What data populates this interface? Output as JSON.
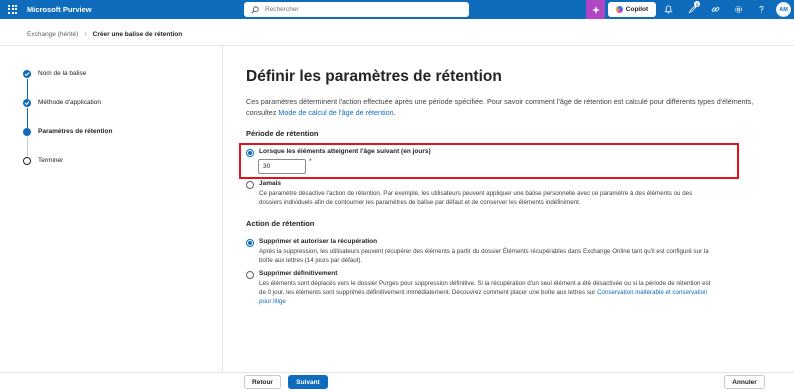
{
  "header": {
    "app_name": "Microsoft Purview",
    "search_placeholder": "Rechercher",
    "copilot_label": "Copilot",
    "notification_count": "1",
    "avatar_initials": "AM",
    "accent": "#0f6cbd",
    "copilot_accent": "#b146c2"
  },
  "breadcrumb": {
    "parent": "Exchange (hérité)",
    "separator": "›",
    "current": "Créer une balise de rétention"
  },
  "steps": [
    {
      "label": "Nom de la balise",
      "state": "done"
    },
    {
      "label": "Méthode d'application",
      "state": "done"
    },
    {
      "label": "Paramètres de rétention",
      "state": "current"
    },
    {
      "label": "Terminer",
      "state": "todo"
    }
  ],
  "main": {
    "title": "Définir les paramètres de rétention",
    "intro_text": "Ces paramètres déterminent l'action effectuée après une période spécifiée. Pour savoir comment l'âge de rétention est calculé pour différents types d'éléments, consultez ",
    "intro_link": "Mode de calcul de l'âge de rétention",
    "intro_end": ".",
    "retention_period_heading": "Période de rétention",
    "period_options": [
      {
        "label": "Lorsque les éléments atteignent l'âge suivant (en jours)",
        "checked": true
      },
      {
        "label": "Jamais",
        "checked": false,
        "desc": "Ce paramètre désactive l'action de rétention. Par exemple, les utilisateurs peuvent appliquer une balise personnelle avec ce paramètre à des éléments ou des dossiers individuels afin de contourner les paramètres de balise par défaut et de conserver les éléments indéfiniment."
      }
    ],
    "days_value": "30",
    "required_mark": "*",
    "retention_action_heading": "Action de rétention",
    "action_options": [
      {
        "label": "Supprimer et autoriser la récupération",
        "checked": true,
        "desc": "Après la suppression, les utilisateurs peuvent récupérer des éléments à partir du dossier Éléments récupérables dans Exchange Online tant qu'il est configuré sur la boîte aux lettres (14 jours par défaut)."
      },
      {
        "label": "Supprimer définitivement",
        "checked": false,
        "desc": "Les éléments sont déplacés vers le dossier Purges pour suppression définitive. Si la récupération d'un seul élément a été désactivée ou si la période de rétention est de 0 jour, les éléments sont supprimés définitivement immédiatement. Découvrez comment placer une boîte aux lettres sur ",
        "link": "Conservation inaltérable et conservation pour litige"
      }
    ]
  },
  "footer": {
    "back_label": "Retour",
    "next_label": "Suivant",
    "cancel_label": "Annuler"
  }
}
